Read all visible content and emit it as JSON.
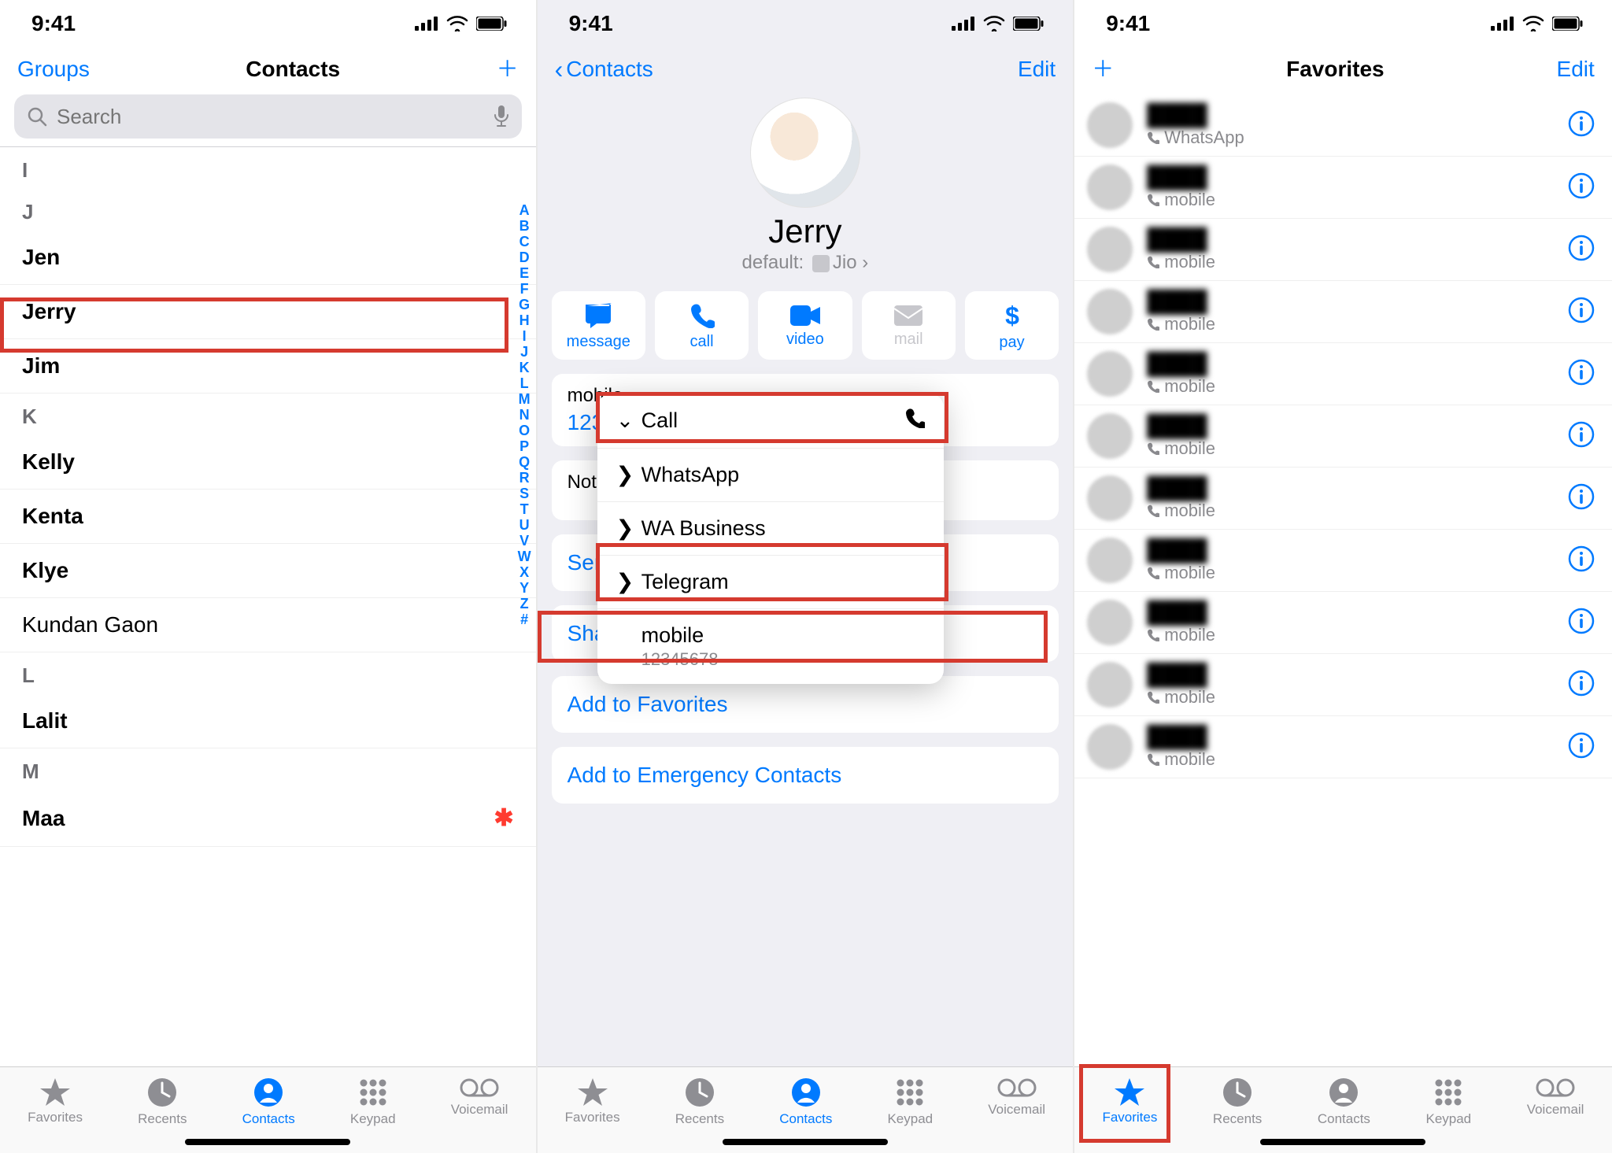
{
  "status_time": "9:41",
  "screen1": {
    "nav_left": "Groups",
    "nav_title": "Contacts",
    "search_placeholder": "Search",
    "sections": [
      {
        "letter": "I",
        "rows": []
      },
      {
        "letter": "J",
        "rows": [
          {
            "name": "Jen",
            "bold": true
          },
          {
            "name": "Jerry",
            "bold": true,
            "highlight": true
          },
          {
            "name": "Jim",
            "bold": true
          }
        ]
      },
      {
        "letter": "K",
        "rows": [
          {
            "name": "Kelly",
            "bold": true
          },
          {
            "name": "Kenta",
            "bold": true
          },
          {
            "name": "Klye",
            "bold": true
          },
          {
            "name": "Kundan",
            "last": "Gaon",
            "bold": false
          }
        ]
      },
      {
        "letter": "L",
        "rows": [
          {
            "name": "Lalit",
            "bold": true
          }
        ]
      },
      {
        "letter": "M",
        "rows": [
          {
            "name": "Maa",
            "bold": true,
            "emergency": true
          }
        ]
      }
    ],
    "alpha": [
      "A",
      "B",
      "C",
      "D",
      "E",
      "F",
      "G",
      "H",
      "I",
      "J",
      "K",
      "L",
      "M",
      "N",
      "O",
      "P",
      "Q",
      "R",
      "S",
      "T",
      "U",
      "V",
      "W",
      "X",
      "Y",
      "Z",
      "#"
    ],
    "tabs": {
      "active": "Contacts"
    }
  },
  "screen2": {
    "back": "Contacts",
    "edit": "Edit",
    "name": "Jerry",
    "default_label": "default:",
    "default_sim": "Jio",
    "actions": [
      {
        "key": "message",
        "label": "message",
        "enabled": true
      },
      {
        "key": "call",
        "label": "call",
        "enabled": true
      },
      {
        "key": "video",
        "label": "video",
        "enabled": true
      },
      {
        "key": "mail",
        "label": "mail",
        "enabled": false
      },
      {
        "key": "pay",
        "label": "pay",
        "enabled": true
      }
    ],
    "mobile_label": "mobile",
    "mobile_value": "12345",
    "notes_label": "Notes",
    "send": "Send",
    "share": "Share",
    "add_fav": "Add to Favorites",
    "add_emg": "Add to Emergency Contacts",
    "popup": {
      "head": "Call",
      "apps": [
        "WhatsApp",
        "WA Business",
        "Telegram"
      ],
      "num_label": "mobile",
      "num_value": "12345678"
    },
    "tabs": {
      "active": "Contacts"
    }
  },
  "screen3": {
    "nav_title": "Favorites",
    "edit": "Edit",
    "items": [
      {
        "kind": "WhatsApp"
      },
      {
        "kind": "mobile"
      },
      {
        "kind": "mobile"
      },
      {
        "kind": "mobile"
      },
      {
        "kind": "mobile"
      },
      {
        "kind": "mobile"
      },
      {
        "kind": "mobile"
      },
      {
        "kind": "mobile"
      },
      {
        "kind": "mobile"
      },
      {
        "kind": "mobile"
      },
      {
        "kind": "mobile"
      }
    ],
    "tabs": {
      "active": "Favorites"
    }
  },
  "tablabels": {
    "favorites": "Favorites",
    "recents": "Recents",
    "contacts": "Contacts",
    "keypad": "Keypad",
    "voicemail": "Voicemail"
  }
}
